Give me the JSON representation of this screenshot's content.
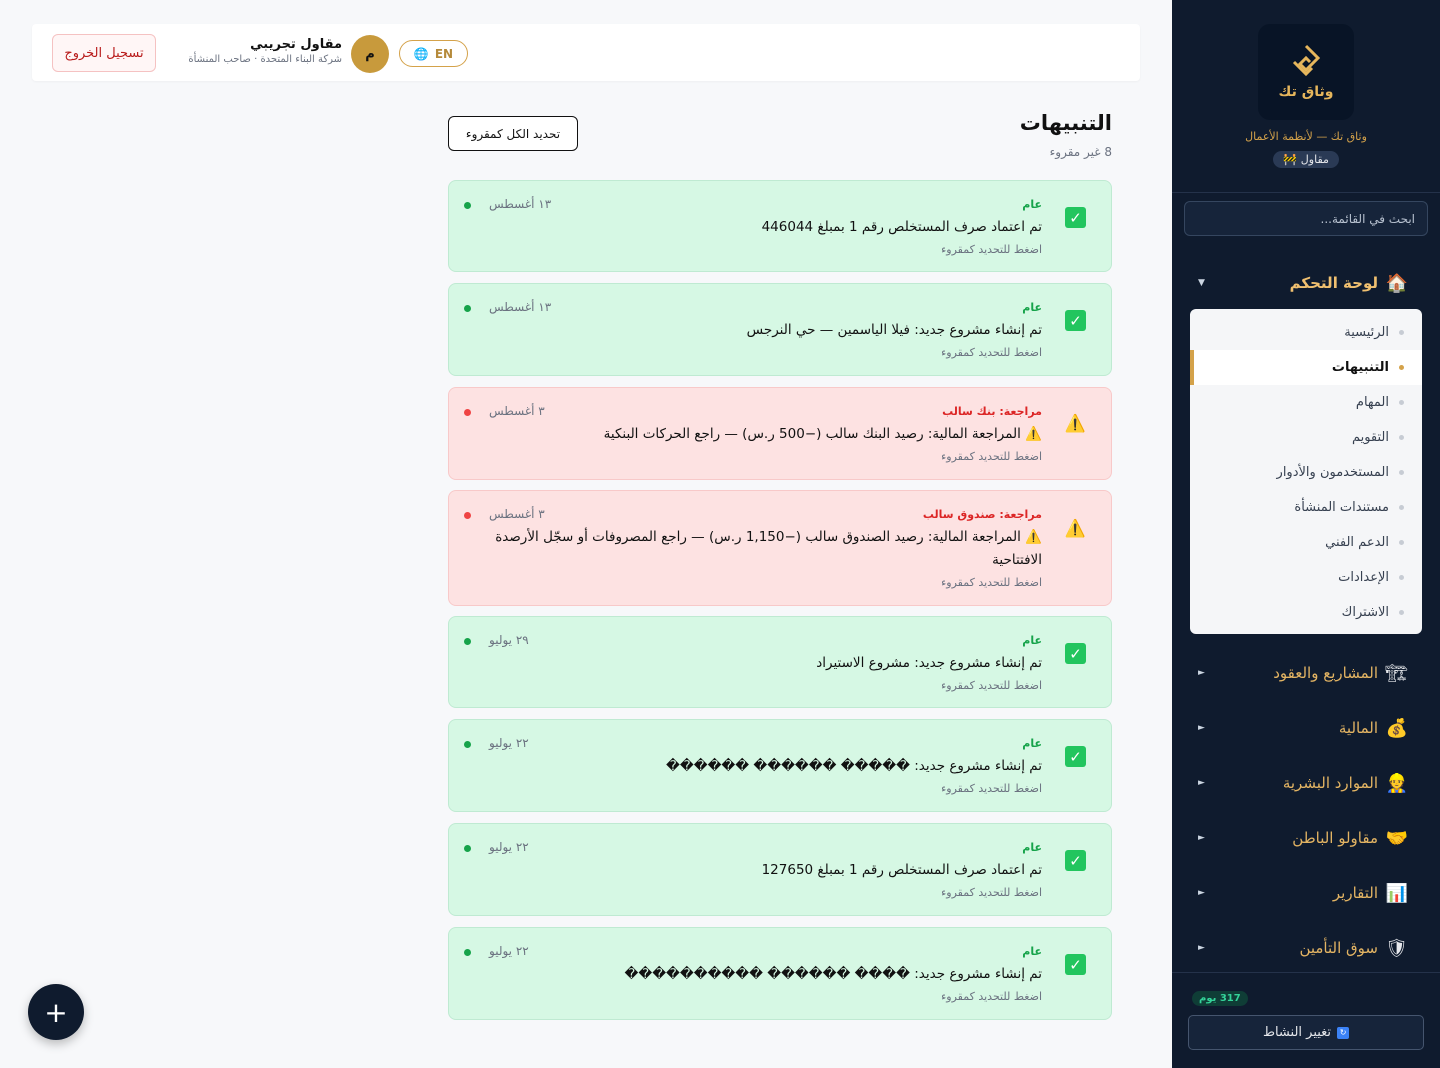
{
  "sidebar": {
    "logo_text": "وثاق تك",
    "tagline": "وثاق تك — لأنظمة الأعمال",
    "role": "مقاول",
    "role_icon": "construction-icon",
    "search_placeholder": "ابحث في القائمة...",
    "groups": [
      {
        "label": "لوحة التحكم",
        "icon": "🏠",
        "expanded": true
      },
      {
        "label": "المشاريع والعقود",
        "icon": "🏗",
        "expanded": false
      },
      {
        "label": "المالية",
        "icon": "💰",
        "expanded": false
      },
      {
        "label": "الموارد البشرية",
        "icon": "👷",
        "expanded": false
      },
      {
        "label": "مقاولو الباطن",
        "icon": "🤝",
        "expanded": false
      },
      {
        "label": "التقارير",
        "icon": "📊",
        "expanded": false
      },
      {
        "label": "سوق التأمين",
        "icon": "🛡",
        "expanded": false
      }
    ],
    "subitems": [
      {
        "label": "الرئيسية"
      },
      {
        "label": "التنبيهات",
        "active": true
      },
      {
        "label": "المهام"
      },
      {
        "label": "التقويم"
      },
      {
        "label": "المستخدمون والأدوار"
      },
      {
        "label": "مستندات المنشأة"
      },
      {
        "label": "الدعم الفني"
      },
      {
        "label": "الإعدادات"
      },
      {
        "label": "الاشتراك"
      }
    ],
    "days_left": "317 يوم",
    "switch_label": "تغيير النشاط"
  },
  "topbar": {
    "user_name": "مقاول تجريبي",
    "user_sub": "شركة البناء المتحدة · صاحب المنشأة",
    "avatar_letter": "م",
    "lang": "EN",
    "logout": "تسجيل الخروج"
  },
  "page": {
    "title": "التنبيهات",
    "unread": "8 غير مقروء",
    "mark_all": "تحديد الكل كمقروء"
  },
  "notifications": [
    {
      "type": "ok",
      "category": "عام",
      "message": "تم اعتماد صرف المستخلص رقم 1 بمبلغ 446044",
      "hint": "اضغط للتحديد كمقروء",
      "date": "١٣ أغسطس"
    },
    {
      "type": "ok",
      "category": "عام",
      "message": "تم إنشاء مشروع جديد: فيلا الياسمين — حي النرجس",
      "hint": "اضغط للتحديد كمقروء",
      "date": "١٣ أغسطس"
    },
    {
      "type": "warn",
      "category": "مراجعة: بنك سالب",
      "message": "⚠️ المراجعة المالية: رصيد البنك سالب (−500 ر.س) — راجع الحركات البنكية",
      "hint": "اضغط للتحديد كمقروء",
      "date": "٣ أغسطس"
    },
    {
      "type": "warn",
      "category": "مراجعة: صندوق سالب",
      "message": "⚠️ المراجعة المالية: رصيد الصندوق سالب (−1,150 ر.س) — راجع المصروفات أو سجّل الأرصدة الافتتاحية",
      "hint": "اضغط للتحديد كمقروء",
      "date": "٣ أغسطس"
    },
    {
      "type": "ok",
      "category": "عام",
      "message": "تم إنشاء مشروع جديد: مشروع الاستيراد",
      "hint": "اضغط للتحديد كمقروء",
      "date": "٢٩ يوليو"
    },
    {
      "type": "ok",
      "category": "عام",
      "message": "تم إنشاء مشروع جديد: ����� ������ ������",
      "hint": "اضغط للتحديد كمقروء",
      "date": "٢٢ يوليو"
    },
    {
      "type": "ok",
      "category": "عام",
      "message": "تم اعتماد صرف المستخلص رقم 1 بمبلغ 127650",
      "hint": "اضغط للتحديد كمقروء",
      "date": "٢٢ يوليو"
    },
    {
      "type": "ok",
      "category": "عام",
      "message": "تم إنشاء مشروع جديد: ���� ������ ����������",
      "hint": "اضغط للتحديد كمقروء",
      "date": "٢٢ يوليو"
    }
  ],
  "colors": {
    "sidebar_bg": "#0f1b2e",
    "accent": "#d4a24a",
    "ok_bg": "#d6f8e4",
    "warn_bg": "#fde2e2"
  }
}
